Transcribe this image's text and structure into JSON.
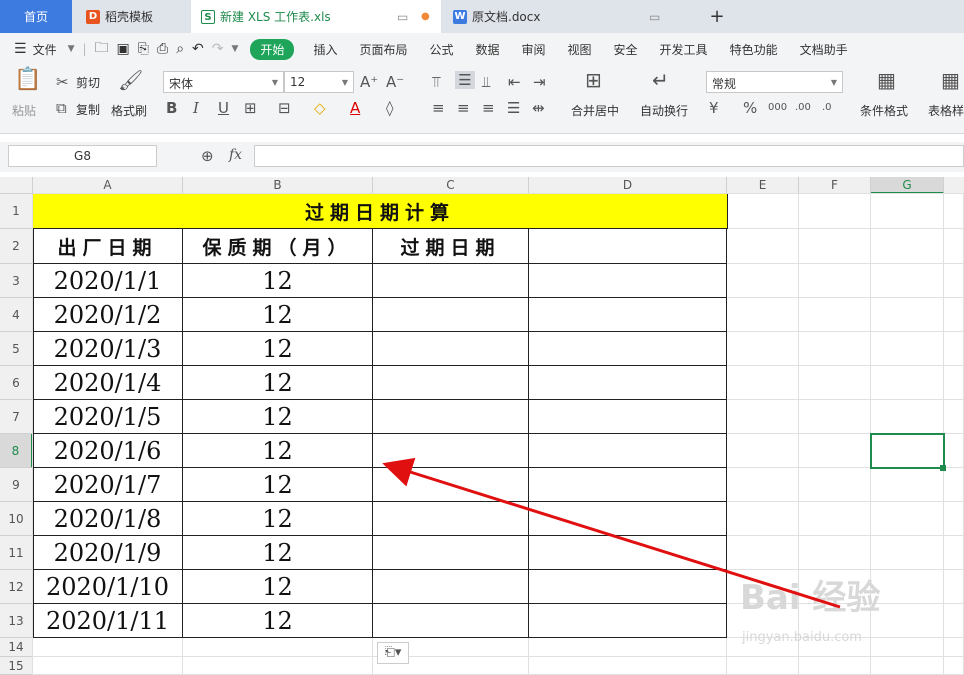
{
  "tabs": {
    "home": "首页",
    "daoke": "稻壳模板",
    "xls": "新建 XLS 工作表.xls",
    "doc": "原文档.docx",
    "new_tab": "+"
  },
  "menu": {
    "file": "文件",
    "items": [
      "开始",
      "插入",
      "页面布局",
      "公式",
      "数据",
      "审阅",
      "视图",
      "安全",
      "开发工具",
      "特色功能",
      "文档助手"
    ]
  },
  "ribbon": {
    "paste": "粘贴",
    "cut": "剪切",
    "copy": "复制",
    "format_painter": "格式刷",
    "font_name": "宋体",
    "font_size": "12",
    "merge_center": "合并居中",
    "wrap_text": "自动换行",
    "number_format": "常规",
    "cond_format": "条件格式",
    "table_style": "表格样"
  },
  "formula_bar": {
    "name_box": "G8",
    "fx": "fx",
    "formula": ""
  },
  "columns": [
    "A",
    "B",
    "C",
    "D",
    "E",
    "F",
    "G"
  ],
  "rows": [
    "1",
    "2",
    "3",
    "4",
    "5",
    "6",
    "7",
    "8",
    "9",
    "10",
    "11",
    "12",
    "13",
    "14",
    "15"
  ],
  "sheet": {
    "title": "过期日期计算",
    "headers": [
      "出厂日期",
      "保质期（月）",
      "过期日期",
      ""
    ],
    "data": [
      [
        "2020/1/1",
        "12"
      ],
      [
        "2020/1/2",
        "12"
      ],
      [
        "2020/1/3",
        "12"
      ],
      [
        "2020/1/4",
        "12"
      ],
      [
        "2020/1/5",
        "12"
      ],
      [
        "2020/1/6",
        "12"
      ],
      [
        "2020/1/7",
        "12"
      ],
      [
        "2020/1/8",
        "12"
      ],
      [
        "2020/1/9",
        "12"
      ],
      [
        "2020/1/10",
        "12"
      ],
      [
        "2020/1/11",
        "12"
      ]
    ]
  },
  "watermark": {
    "main": "Bai 经验",
    "sub": "jingyan.baidu.com"
  },
  "colors": {
    "accent": "#1ea55a",
    "title_fill": "#ffff00",
    "selection": "#1f8b4c",
    "arrow": "#e01010"
  }
}
